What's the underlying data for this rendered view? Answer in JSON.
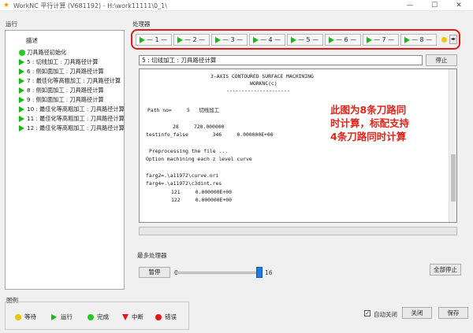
{
  "window": {
    "title": "WorkNC 平行计算 (V681192) - H:\\work11111\\0_1\\",
    "minimize": "—",
    "maximize": "☐",
    "close": "✕"
  },
  "run_panel": {
    "label": "运行",
    "header": "描述",
    "items": [
      {
        "icon": "dot",
        "label": "刀具路径初始化"
      },
      {
        "icon": "play",
        "label": "5 : 切线加工 : 刀具路径计算"
      },
      {
        "icon": "play",
        "label": "6 : 侧如面加工 : 刀具路径计算"
      },
      {
        "icon": "play",
        "label": "7 : 最佳化等高粗加工 : 刀具路径计算"
      },
      {
        "icon": "play",
        "label": "8 : 侧如面加工 : 刀具路径计算"
      },
      {
        "icon": "play",
        "label": "9 : 侧如面加工 : 刀具路径计算"
      },
      {
        "icon": "play",
        "label": "10 : 最佳化等高粗加工 : 刀具路径计算"
      },
      {
        "icon": "play",
        "label": "11 : 最佳化等高粗加工 : 刀具路径计算"
      },
      {
        "icon": "play",
        "label": "12 : 最佳化等高粗加工 : 刀具路径计算"
      }
    ]
  },
  "processor_panel": {
    "label": "处理器",
    "tabs": [
      {
        "label": "— 1 —"
      },
      {
        "label": "— 2 —"
      },
      {
        "label": "— 3 —"
      },
      {
        "label": "— 4 —"
      },
      {
        "label": "— 5 —"
      },
      {
        "label": "— 6 —"
      },
      {
        "label": "— 7 —"
      },
      {
        "label": "— 8 —"
      }
    ],
    "current_job": "5 : 切线加工 : 刀具路径计算",
    "stop_button": "停止",
    "log_lines": [
      "3-AXIS CONTOURED SURFACE MACHINING",
      "WORKNC(c)",
      "---------------------",
      "Path no=     5   切线加工",
      "28     720.000000",
      "testinfo_false        346     0.000000E+00",
      "Preprocessing the file ...",
      "Option machining each z level curve",
      "farg2=.\\a11972\\curve.ori",
      "farg4=.\\a11972\\c3dint.res",
      "121     0.000000E+00",
      "122     0.000000E+00"
    ]
  },
  "annotation": {
    "line1": "此图为8条刀路同",
    "line2": "时计算，标配支持",
    "line3": "4条刀路同时计算"
  },
  "max_processors": {
    "label": "最多处理器",
    "pause_button": "暂停",
    "min": "0",
    "max": "16",
    "value": 16
  },
  "stop_all_button": "全部停止",
  "legend": {
    "label": "图例",
    "items": [
      {
        "icon": "yellow-dot",
        "label": "等待"
      },
      {
        "icon": "green-play",
        "label": "运行"
      },
      {
        "icon": "green-dot",
        "label": "完成"
      },
      {
        "icon": "red-triangle",
        "label": "中断"
      },
      {
        "icon": "red-dot",
        "label": "错误"
      }
    ]
  },
  "auto_close": {
    "label": "自动关闭",
    "checked": true,
    "check_glyph": "✓"
  },
  "close_button": "关闭",
  "save_button": "保存",
  "colors": {
    "highlight_red": "#e41a1a",
    "running_green": "#11bb11",
    "waiting_yellow": "#f2c200",
    "slider_blue": "#1e7be0"
  }
}
